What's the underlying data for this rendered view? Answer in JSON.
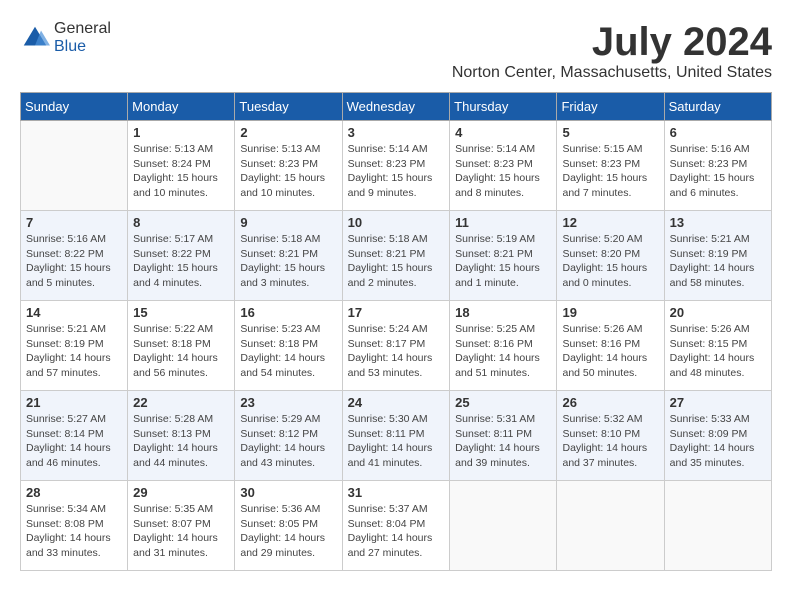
{
  "header": {
    "logo_general": "General",
    "logo_blue": "Blue",
    "month_title": "July 2024",
    "location": "Norton Center, Massachusetts, United States"
  },
  "weekdays": [
    "Sunday",
    "Monday",
    "Tuesday",
    "Wednesday",
    "Thursday",
    "Friday",
    "Saturday"
  ],
  "weeks": [
    [
      {
        "day": "",
        "info": ""
      },
      {
        "day": "1",
        "info": "Sunrise: 5:13 AM\nSunset: 8:24 PM\nDaylight: 15 hours\nand 10 minutes."
      },
      {
        "day": "2",
        "info": "Sunrise: 5:13 AM\nSunset: 8:23 PM\nDaylight: 15 hours\nand 10 minutes."
      },
      {
        "day": "3",
        "info": "Sunrise: 5:14 AM\nSunset: 8:23 PM\nDaylight: 15 hours\nand 9 minutes."
      },
      {
        "day": "4",
        "info": "Sunrise: 5:14 AM\nSunset: 8:23 PM\nDaylight: 15 hours\nand 8 minutes."
      },
      {
        "day": "5",
        "info": "Sunrise: 5:15 AM\nSunset: 8:23 PM\nDaylight: 15 hours\nand 7 minutes."
      },
      {
        "day": "6",
        "info": "Sunrise: 5:16 AM\nSunset: 8:23 PM\nDaylight: 15 hours\nand 6 minutes."
      }
    ],
    [
      {
        "day": "7",
        "info": "Sunrise: 5:16 AM\nSunset: 8:22 PM\nDaylight: 15 hours\nand 5 minutes."
      },
      {
        "day": "8",
        "info": "Sunrise: 5:17 AM\nSunset: 8:22 PM\nDaylight: 15 hours\nand 4 minutes."
      },
      {
        "day": "9",
        "info": "Sunrise: 5:18 AM\nSunset: 8:21 PM\nDaylight: 15 hours\nand 3 minutes."
      },
      {
        "day": "10",
        "info": "Sunrise: 5:18 AM\nSunset: 8:21 PM\nDaylight: 15 hours\nand 2 minutes."
      },
      {
        "day": "11",
        "info": "Sunrise: 5:19 AM\nSunset: 8:21 PM\nDaylight: 15 hours\nand 1 minute."
      },
      {
        "day": "12",
        "info": "Sunrise: 5:20 AM\nSunset: 8:20 PM\nDaylight: 15 hours\nand 0 minutes."
      },
      {
        "day": "13",
        "info": "Sunrise: 5:21 AM\nSunset: 8:19 PM\nDaylight: 14 hours\nand 58 minutes."
      }
    ],
    [
      {
        "day": "14",
        "info": "Sunrise: 5:21 AM\nSunset: 8:19 PM\nDaylight: 14 hours\nand 57 minutes."
      },
      {
        "day": "15",
        "info": "Sunrise: 5:22 AM\nSunset: 8:18 PM\nDaylight: 14 hours\nand 56 minutes."
      },
      {
        "day": "16",
        "info": "Sunrise: 5:23 AM\nSunset: 8:18 PM\nDaylight: 14 hours\nand 54 minutes."
      },
      {
        "day": "17",
        "info": "Sunrise: 5:24 AM\nSunset: 8:17 PM\nDaylight: 14 hours\nand 53 minutes."
      },
      {
        "day": "18",
        "info": "Sunrise: 5:25 AM\nSunset: 8:16 PM\nDaylight: 14 hours\nand 51 minutes."
      },
      {
        "day": "19",
        "info": "Sunrise: 5:26 AM\nSunset: 8:16 PM\nDaylight: 14 hours\nand 50 minutes."
      },
      {
        "day": "20",
        "info": "Sunrise: 5:26 AM\nSunset: 8:15 PM\nDaylight: 14 hours\nand 48 minutes."
      }
    ],
    [
      {
        "day": "21",
        "info": "Sunrise: 5:27 AM\nSunset: 8:14 PM\nDaylight: 14 hours\nand 46 minutes."
      },
      {
        "day": "22",
        "info": "Sunrise: 5:28 AM\nSunset: 8:13 PM\nDaylight: 14 hours\nand 44 minutes."
      },
      {
        "day": "23",
        "info": "Sunrise: 5:29 AM\nSunset: 8:12 PM\nDaylight: 14 hours\nand 43 minutes."
      },
      {
        "day": "24",
        "info": "Sunrise: 5:30 AM\nSunset: 8:11 PM\nDaylight: 14 hours\nand 41 minutes."
      },
      {
        "day": "25",
        "info": "Sunrise: 5:31 AM\nSunset: 8:11 PM\nDaylight: 14 hours\nand 39 minutes."
      },
      {
        "day": "26",
        "info": "Sunrise: 5:32 AM\nSunset: 8:10 PM\nDaylight: 14 hours\nand 37 minutes."
      },
      {
        "day": "27",
        "info": "Sunrise: 5:33 AM\nSunset: 8:09 PM\nDaylight: 14 hours\nand 35 minutes."
      }
    ],
    [
      {
        "day": "28",
        "info": "Sunrise: 5:34 AM\nSunset: 8:08 PM\nDaylight: 14 hours\nand 33 minutes."
      },
      {
        "day": "29",
        "info": "Sunrise: 5:35 AM\nSunset: 8:07 PM\nDaylight: 14 hours\nand 31 minutes."
      },
      {
        "day": "30",
        "info": "Sunrise: 5:36 AM\nSunset: 8:05 PM\nDaylight: 14 hours\nand 29 minutes."
      },
      {
        "day": "31",
        "info": "Sunrise: 5:37 AM\nSunset: 8:04 PM\nDaylight: 14 hours\nand 27 minutes."
      },
      {
        "day": "",
        "info": ""
      },
      {
        "day": "",
        "info": ""
      },
      {
        "day": "",
        "info": ""
      }
    ]
  ]
}
